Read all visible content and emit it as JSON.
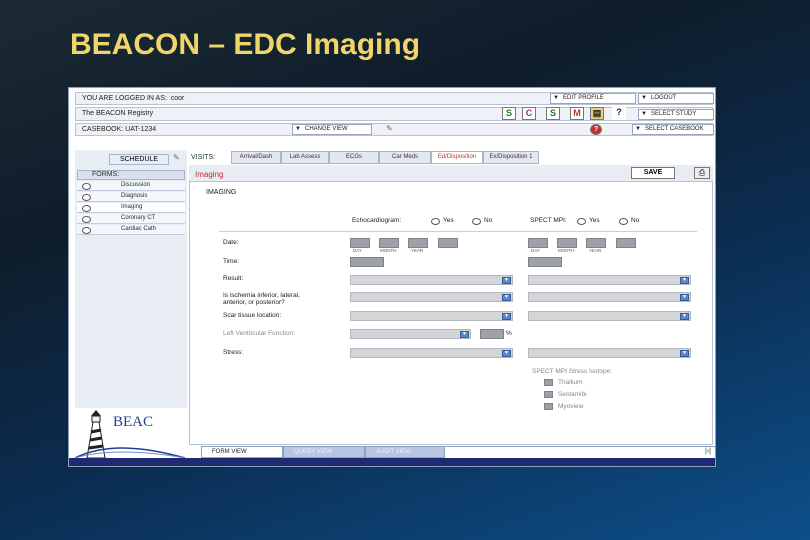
{
  "slide": {
    "title": "BEACON – EDC Imaging"
  },
  "top": {
    "logged_in_label": "YOU ARE LOGGED IN AS:",
    "user": "coor",
    "edit_profile": "EDIT PROFILE",
    "logout": "LOGOUT",
    "registry": "The BEACON Registry",
    "select_study": "SELECT STUDY",
    "casebook": "CASEBOOK: UAT-1234",
    "change_view": "CHANGE VIEW",
    "select_casebook": "SELECT CASEBOOK",
    "icons": [
      "S",
      "C",
      "S",
      "M"
    ]
  },
  "left": {
    "schedule": "SCHEDULE",
    "forms_label": "FORMS:",
    "forms": [
      "Discussion",
      "Diagnosis",
      "Imaging",
      "Coronary CT",
      "Cardiac Cath"
    ],
    "logo_text": "BEAC"
  },
  "visits": {
    "label": "VISITS:",
    "tabs": [
      "Arrival/Dash",
      "Lab Assess",
      "ECGs",
      "Car Meds",
      "Ed/Disposition",
      "Ex/Disposition 1"
    ]
  },
  "form": {
    "title": "Imaging",
    "save": "SAVE",
    "section": "IMAGING",
    "echo_label": "Echocardiogram:",
    "spect_label": "SPECT MPI:",
    "yes": "Yes",
    "no": "No",
    "date_label": "Date:",
    "time_label": "Time:",
    "result_label": "Result:",
    "ischemia_label_1": "Is ischemia inferior, lateral,",
    "ischemia_label_2": "anterior, or posterior?",
    "scar_label": "Scar tissue location:",
    "lvf_label": "Left Ventricular Function:",
    "percent": "%",
    "stress_label": "Stress:",
    "date_caps": [
      "DAY",
      "MONTH",
      "YEAR"
    ],
    "isotope_label": "SPECT MPI Stress Isotope:",
    "isotopes": [
      "Thallium",
      "Sestamibi",
      "Myoview"
    ]
  },
  "bottom_tabs": [
    "FORM VIEW",
    "QUERY VIEW",
    "AUDIT VIEW"
  ],
  "colors": {
    "title": "#f0d66a",
    "accent_red": "#c03030",
    "dropdown_blue": "#5b88c6"
  }
}
